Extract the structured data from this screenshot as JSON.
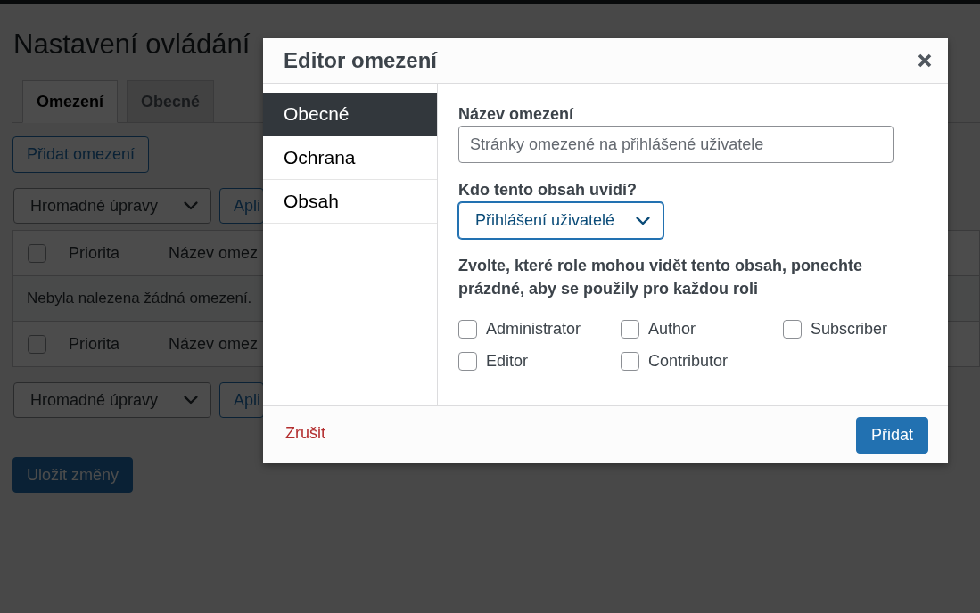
{
  "admin_page": {
    "title": "Nastavení ovládání",
    "tabs": [
      {
        "label": "Omezení",
        "selected": true
      },
      {
        "label": "Obecné",
        "selected": false
      }
    ],
    "add_button": "Přidat omezení",
    "bulk_actions_top": {
      "select": "Hromadné úpravy",
      "apply_button": "Apli"
    },
    "table": {
      "header": {
        "checked": false,
        "columns": [
          "Priorita",
          "Název omez"
        ]
      },
      "empty_message": "Nebyla nalezena žádná omezení.",
      "footer": {
        "checked": false,
        "columns": [
          "Priorita",
          "Název omez"
        ]
      }
    },
    "bulk_actions_bottom": {
      "select": "Hromadné úpravy",
      "apply_button": "Apli"
    },
    "save_button": "Uložit změny"
  },
  "modal": {
    "title": "Editor omezení",
    "sidebar": {
      "items": [
        {
          "label": "Obecné",
          "selected": true
        },
        {
          "label": "Ochrana",
          "selected": false
        },
        {
          "label": "Obsah",
          "selected": false
        }
      ]
    },
    "name_field": {
      "label": "Název omezení",
      "placeholder": "Stránky omezené na přihlášené uživatele"
    },
    "audience_field": {
      "label": "Kdo tento obsah uvidí?",
      "value": "Přihlášení uživatelé",
      "focused": true
    },
    "roles": {
      "label": "Zvolte, které role mohou vidět tento obsah, ponechte prázdné, aby se použily pro každou roli",
      "options": [
        {
          "label": "Administrator",
          "checked": false
        },
        {
          "label": "Author",
          "checked": false
        },
        {
          "label": "Subscriber",
          "checked": false
        },
        {
          "label": "Editor",
          "checked": false
        },
        {
          "label": "Contributor",
          "checked": false
        }
      ]
    },
    "cancel_link": "Zrušit",
    "submit_button": "Přidat"
  }
}
